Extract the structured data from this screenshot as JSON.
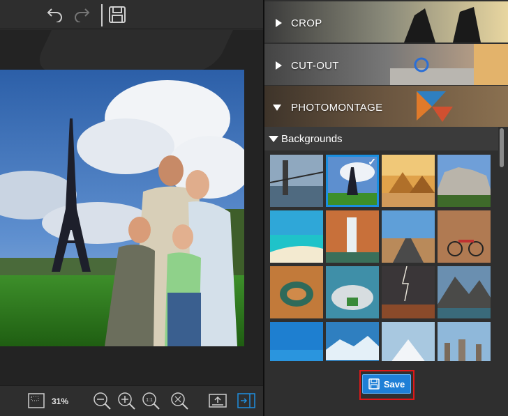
{
  "toolbar": {
    "undo_icon": "undo-arrow",
    "redo_icon": "redo-arrow",
    "save_icon": "floppy-disk"
  },
  "bottom_toolbar": {
    "zoom_level": "31%",
    "icons": [
      "fit-to-screen",
      "zoom-out",
      "zoom-in",
      "actual-size",
      "zoom-fit",
      "export",
      "toggle-panel"
    ]
  },
  "panel": {
    "sections": [
      {
        "label": "CROP",
        "expanded": false
      },
      {
        "label": "CUT-OUT",
        "expanded": false
      },
      {
        "label": "PHOTOMONTAGE",
        "expanded": true
      }
    ],
    "backgrounds": {
      "label": "Backgrounds",
      "selected_index": 1,
      "thumbnails": [
        "brooklyn-bridge",
        "eiffel-tower",
        "pyramids",
        "mount-rushmore",
        "tropical-beach",
        "waterfall",
        "desert-road",
        "bicycle-wall",
        "canyon-bend",
        "island-aerial",
        "lightning-storm",
        "mountain-lake",
        "blue-sky",
        "glacier",
        "snow-mountain",
        "venice"
      ]
    },
    "save_label": "Save"
  },
  "colors": {
    "accent": "#1f7fd6",
    "highlight": "#e01818",
    "panel_bg": "#2f2f2f"
  }
}
